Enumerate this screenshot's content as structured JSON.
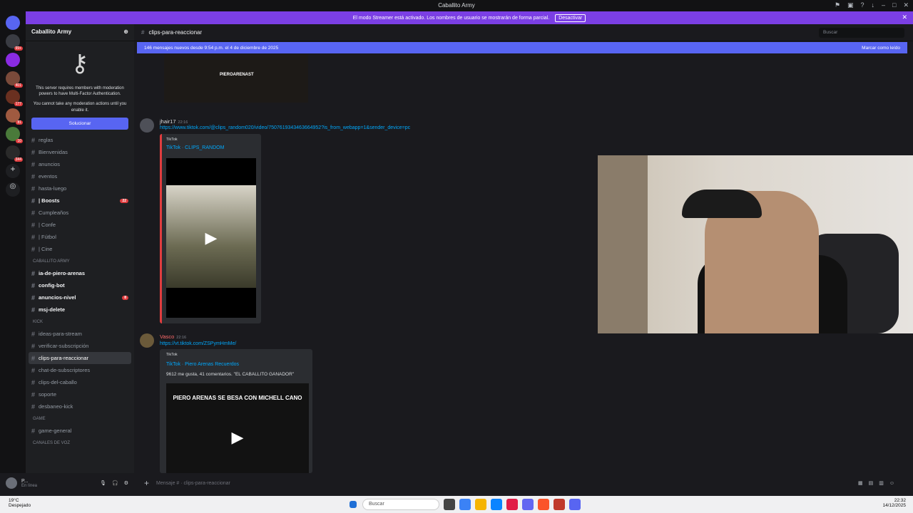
{
  "window": {
    "title": "Caballito Army"
  },
  "streamer_banner": {
    "text": "El modo Streamer está activado. Los nombres de usuario se mostrarán de forma parcial.",
    "button": "Desactivar"
  },
  "server": {
    "name": "Caballito Army",
    "mfa_text": "This server requires members with moderation powers to have Multi-Factor Authentication.",
    "mfa_note": "You cannot take any moderation actions until you enable it.",
    "fix_button": "Solucionar"
  },
  "server_badges": [
    "99+",
    "401",
    "177",
    "81",
    "10",
    "344"
  ],
  "channels": [
    {
      "name": "reglas",
      "bright": false
    },
    {
      "name": "Bienvenidas",
      "bright": false
    },
    {
      "name": "anuncios",
      "bright": false
    },
    {
      "name": "eventos",
      "bright": false
    },
    {
      "name": "hasta-luego",
      "bright": false
    },
    {
      "name": "| Boosts",
      "bright": true,
      "count": "22"
    },
    {
      "name": "Cumpleaños",
      "bright": false
    },
    {
      "name": "| Confe",
      "bright": false
    },
    {
      "name": "| Fútbol",
      "bright": false
    },
    {
      "name": "| Cine",
      "bright": false
    }
  ],
  "cat1": "CABALLITO ARMY",
  "channels2": [
    {
      "name": "ia-de-piero-arenas",
      "bright": true
    },
    {
      "name": "config-bot",
      "bright": true
    },
    {
      "name": "anuncios-nivel",
      "bright": true,
      "count": "8"
    },
    {
      "name": "msj-delete",
      "bright": true
    }
  ],
  "cat2": "KICK",
  "channels3": [
    {
      "name": "ideas-para-stream"
    },
    {
      "name": "verificar-subscripción"
    },
    {
      "name": "clips-para-reaccionar",
      "active": true
    },
    {
      "name": "chat-de-subscriptores"
    },
    {
      "name": "clips-del-caballo"
    },
    {
      "name": "soporte"
    },
    {
      "name": "desbaneo-kick"
    }
  ],
  "cat3": "GAME",
  "channels4": [
    {
      "name": "game-general"
    }
  ],
  "cat4": "CANALES DE VOZ",
  "user": {
    "name": "P...",
    "status": "En línea"
  },
  "header": {
    "channel": "clips-para-reaccionar",
    "search": "Buscar"
  },
  "new_messages": {
    "text": "146 mensajes nuevos desde 9:54 p.m. el 4 de diciembre de 2025",
    "action": "Marcar como leído"
  },
  "messages": [
    {
      "author": "jhair17",
      "time": "22:16",
      "link": "https://www.tiktok.com/@clips_random020/video/7507619343463664952?is_from_webapp=1&sender_device=pc",
      "provider": "TikTok",
      "embed_title": "TikTok · CLIPS_RANDOM"
    },
    {
      "author": "Vasco",
      "time": "22:16",
      "link": "https://vt.tiktok.com/ZSPymHmMe/",
      "provider": "TikTok",
      "embed_title": "TikTok · Piero Arenas Recuerdos",
      "embed_desc": "9612 me gusta, 41 comentarios. \"EL CABALLITO GANADOR\"",
      "video_text": "PIERO ARENAS SE BESA CON MICHELL CANO"
    }
  ],
  "top_image_text": "PIEROARENAST",
  "composer": {
    "placeholder": "Mensaje #  · clips-para-reaccionar"
  },
  "taskbar": {
    "weather": "19°C",
    "weather_desc": "Despejado",
    "search": "Buscar",
    "time": "22:32",
    "date": "14/12/2025"
  }
}
